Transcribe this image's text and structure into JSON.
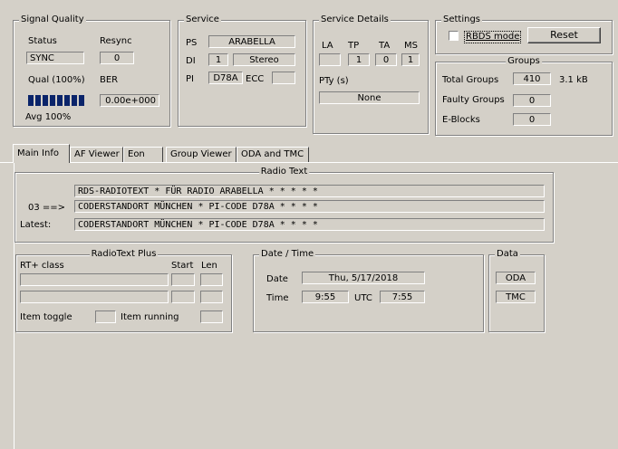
{
  "signal_quality": {
    "title": "Signal Quality",
    "status_label": "Status",
    "resync_label": "Resync",
    "status_value": "SYNC",
    "resync_value": "0",
    "qual_label": "Qual (100%)",
    "ber_label": "BER",
    "quality_level_percent": 100,
    "ber_value": "0.00e+000",
    "avg_label": "Avg 100%"
  },
  "service": {
    "title": "Service",
    "ps_label": "PS",
    "ps_value": "ARABELLA",
    "di_label": "DI",
    "di_value": "1",
    "di_mode": "Stereo",
    "pi_label": "PI",
    "pi_value": "D78A",
    "ecc_label": "ECC",
    "ecc_value": ""
  },
  "service_details": {
    "title": "Service Details",
    "la_label": "LA",
    "tp_label": "TP",
    "ta_label": "TA",
    "ms_label": "MS",
    "la_value": "",
    "tp_value": "1",
    "ta_value": "0",
    "ms_value": "1",
    "pty_label": "PTy (s)",
    "pty_value": "None"
  },
  "settings": {
    "title": "Settings",
    "rbds_label": "RBDS mode",
    "rbds_checked": false,
    "reset_label": "Reset"
  },
  "groups": {
    "title": "Groups",
    "total_label": "Total Groups",
    "total_value": "410",
    "size_value": "3.1 kB",
    "faulty_label": "Faulty Groups",
    "faulty_value": "0",
    "eblocks_label": "E-Blocks",
    "eblocks_value": "0"
  },
  "tabs": [
    {
      "label": "Main Info",
      "active": true
    },
    {
      "label": "AF Viewer",
      "active": false
    },
    {
      "label": "Eon",
      "active": false
    },
    {
      "label": "Group Viewer",
      "active": false
    },
    {
      "label": "ODA and TMC",
      "active": false
    }
  ],
  "radio_text": {
    "title": "Radio Text",
    "line1": "RDS-RADIOTEXT  *  FÜR  RADIO  ARABELLA   *   *   *   *   *",
    "line2_prefix": "03 ==>",
    "line2": "CODERSTANDORT   MÜNCHEN   *  PI-CODE D78A   *   *   *   *",
    "latest_label": "Latest:",
    "latest": "CODERSTANDORT   MÜNCHEN   *  PI-CODE D78A   *   *   *   *"
  },
  "radiotext_plus": {
    "title": "RadioText Plus",
    "class_label": "RT+ class",
    "start_label": "Start",
    "len_label": "Len",
    "item_toggle_label": "Item toggle",
    "item_running_label": "Item running"
  },
  "date_time": {
    "title": "Date / Time",
    "date_label": "Date",
    "date_value": "Thu, 5/17/2018",
    "time_label": "Time",
    "time_value": "9:55",
    "utc_label": "UTC",
    "utc_value": "7:55"
  },
  "data_box": {
    "title": "Data",
    "oda_label": "ODA",
    "tmc_label": "TMC"
  },
  "colors": {
    "window_bg": "#d4d0c8",
    "led_fill": "#0a246a"
  }
}
